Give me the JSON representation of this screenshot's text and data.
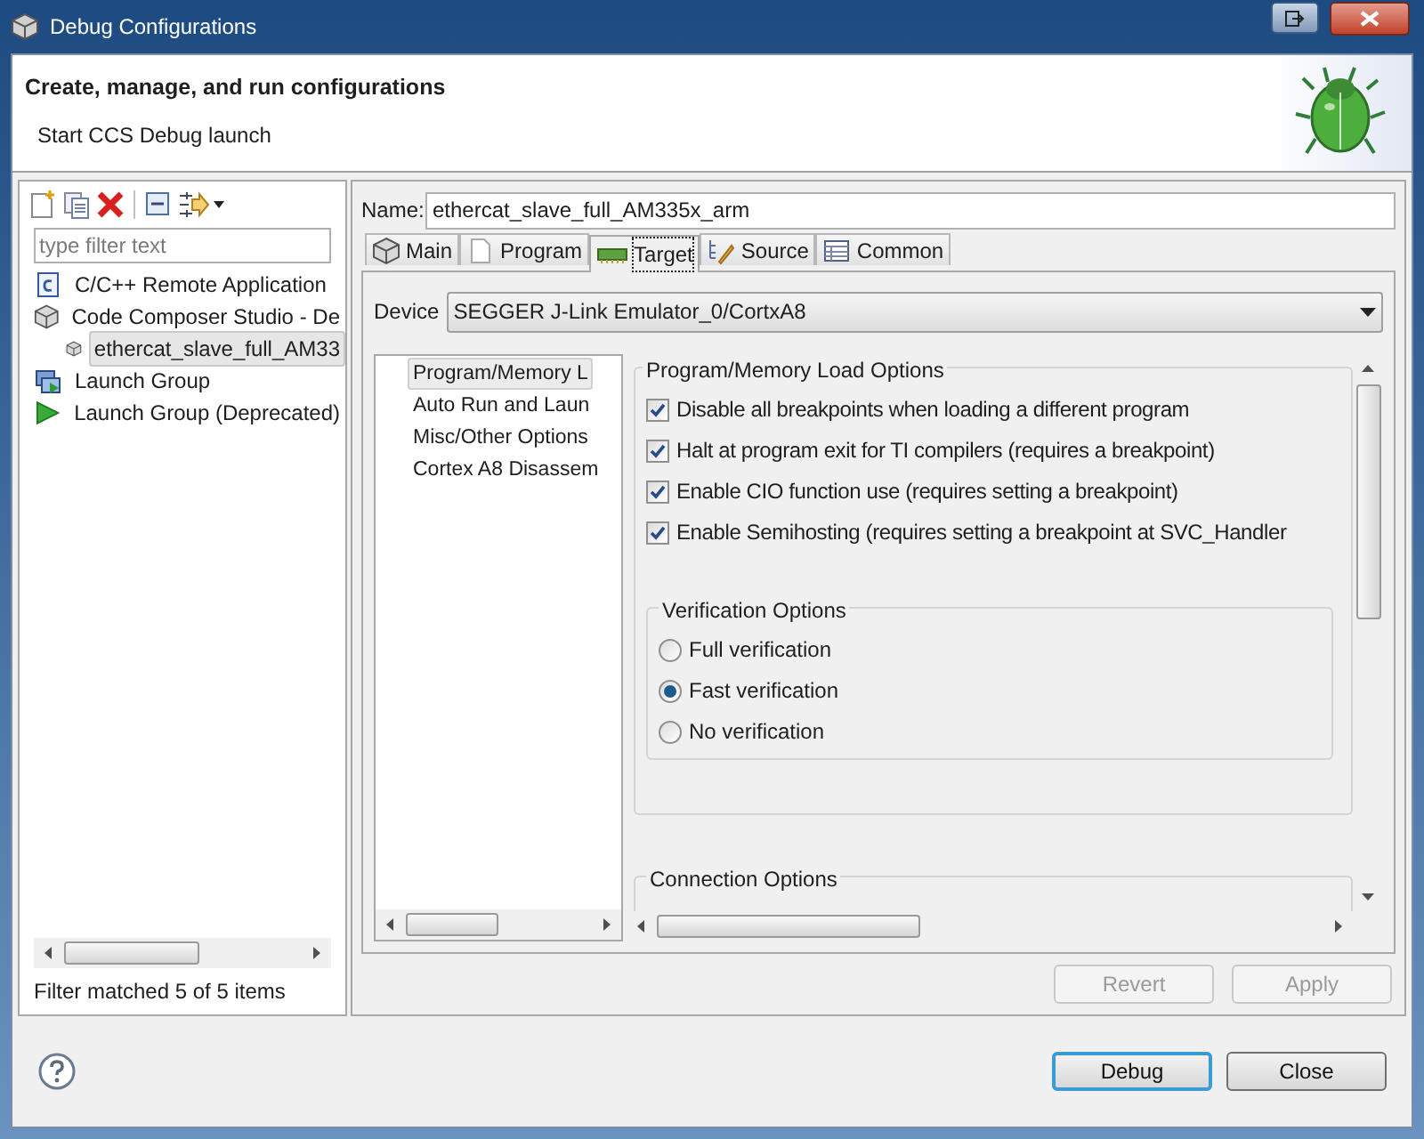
{
  "window": {
    "title": "Debug Configurations"
  },
  "header": {
    "title": "Create, manage, and run configurations",
    "subtitle": "Start CCS Debug launch"
  },
  "filter": {
    "placeholder": "type filter text"
  },
  "tree": [
    {
      "label": "C/C++ Remote Application",
      "selected": false
    },
    {
      "label": "Code Composer Studio - De",
      "selected": false,
      "children": [
        {
          "label": "ethercat_slave_full_AM33",
          "selected": true
        }
      ]
    },
    {
      "label": "Launch Group",
      "selected": false
    },
    {
      "label": "Launch Group (Deprecated)",
      "selected": false
    }
  ],
  "filter_status": "Filter matched 5 of 5 items",
  "name": {
    "label": "Name:",
    "value": "ethercat_slave_full_AM335x_arm"
  },
  "tabs": [
    {
      "label": "Main",
      "selected": false
    },
    {
      "label": "Program",
      "selected": false
    },
    {
      "label": "Target",
      "selected": true
    },
    {
      "label": "Source",
      "selected": false
    },
    {
      "label": "Common",
      "selected": false
    }
  ],
  "device": {
    "label": "Device",
    "value": "SEGGER J-Link Emulator_0/CortxA8"
  },
  "categories": [
    {
      "label": "Program/Memory L",
      "selected": true
    },
    {
      "label": "Auto Run and Laun",
      "selected": false
    },
    {
      "label": "Misc/Other Options",
      "selected": false
    },
    {
      "label": "Cortex A8 Disassem",
      "selected": false
    }
  ],
  "load_options": {
    "title": "Program/Memory Load Options",
    "items": [
      {
        "label": "Disable all breakpoints when loading a different program",
        "checked": true
      },
      {
        "label": "Halt at program exit for TI compilers (requires a breakpoint)",
        "checked": true
      },
      {
        "label": "Enable CIO function use (requires setting a breakpoint)",
        "checked": true
      },
      {
        "label": "Enable Semihosting (requires setting a breakpoint at SVC_Handler",
        "checked": true
      }
    ]
  },
  "verification": {
    "title": "Verification Options",
    "options": [
      {
        "label": "Full verification",
        "selected": false
      },
      {
        "label": "Fast verification",
        "selected": true
      },
      {
        "label": "No verification",
        "selected": false
      }
    ]
  },
  "connection": {
    "title": "Connection Options"
  },
  "buttons": [
    {
      "label": "Revert",
      "disabled": true,
      "kind": "page"
    },
    {
      "label": "Apply",
      "disabled": true,
      "kind": "page"
    },
    {
      "label": "Debug",
      "disabled": false,
      "kind": "dialog",
      "default": true
    },
    {
      "label": "Close",
      "disabled": false,
      "kind": "dialog",
      "default": false
    }
  ]
}
